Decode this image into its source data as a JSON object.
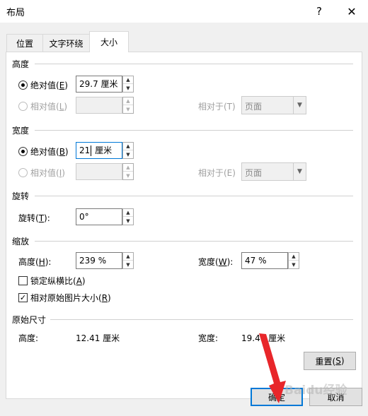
{
  "window": {
    "title": "布局",
    "help": "?",
    "close": "✕"
  },
  "tabs": [
    {
      "label": "位置"
    },
    {
      "label": "文字环绕"
    },
    {
      "label": "大小"
    }
  ],
  "height": {
    "section": "高度",
    "absolute_label": "绝对值(",
    "absolute_key": "E",
    "absolute_value": "29.7 厘米",
    "relative_label": "相对值(",
    "relative_key": "L",
    "relative_to_label": "相对于(T)",
    "relative_to_value": "页面"
  },
  "width": {
    "section": "宽度",
    "absolute_label": "绝对值(",
    "absolute_key": "B",
    "absolute_value_a": "21",
    "absolute_value_b": " 厘米",
    "relative_label": "相对值(",
    "relative_key": "I",
    "relative_to_label": "相对于(E)",
    "relative_to_value": "页面"
  },
  "rotation": {
    "section": "旋转",
    "label": "旋转(",
    "key": "T",
    "value": "0°"
  },
  "scale": {
    "section": "缩放",
    "height_label": "高度(",
    "height_key": "H",
    "height_value": "239 %",
    "width_label": "宽度(",
    "width_key": "W",
    "width_value": "47 %",
    "lock_label": "锁定纵横比(",
    "lock_key": "A",
    "lock_checked": false,
    "relative_label": "相对原始图片大小(",
    "relative_key": "R",
    "relative_checked": true
  },
  "original": {
    "section": "原始尺寸",
    "height_label": "高度:",
    "height_value": "12.41 厘米",
    "width_label": "宽度:",
    "width_value": "19.48 厘米"
  },
  "buttons": {
    "reset": "重置(",
    "reset_key": "S",
    "ok": "确定",
    "cancel": "取消"
  },
  "watermark": "Baidu经验",
  "colors": {
    "accent": "#0078d7",
    "arrow": "#e8262a"
  }
}
